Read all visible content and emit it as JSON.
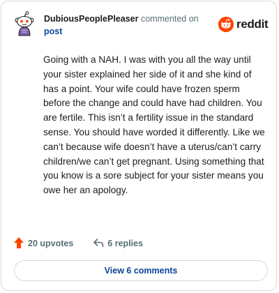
{
  "comment": {
    "author": "DubiousPeoplePleaser",
    "action_text": "commented on",
    "target_link": "post",
    "body": "Going with a NAH. I was with you all the way until your sister explained her side of it and she kind of has a point. Your wife could have frozen sperm before the change and could have had children. You are fertile. This isn’t a fertility issue in the standard sense. You should have worded it differently. Like we can’t because wife doesn’t have a uterus/can’t carry children/we can’t get pregnant. Using something that you know is a sore subject for your sister means you owe her an apology."
  },
  "brand": {
    "name": "reddit",
    "icon": "reddit-logo-icon",
    "color": "#ff4500"
  },
  "stats": {
    "upvotes_label": "20 upvotes",
    "upvote_icon": "upvote-arrow-icon",
    "upvote_color": "#ff4500",
    "replies_label": "6 replies",
    "reply_icon": "reply-arrow-icon"
  },
  "actions": {
    "view_comments_label": "View 6 comments"
  },
  "avatar": {
    "icon": "snoo-avatar-icon",
    "accent": "#7a5fa8"
  }
}
